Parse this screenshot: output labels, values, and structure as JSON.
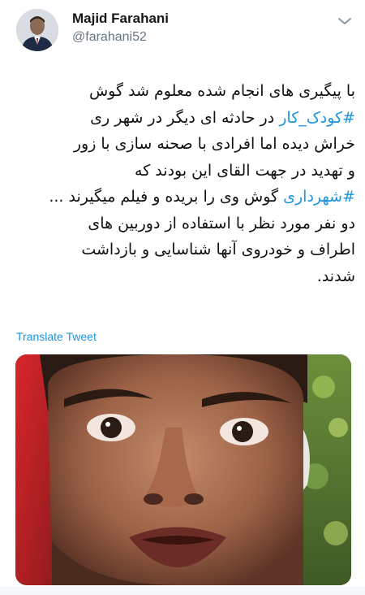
{
  "tweet": {
    "author": {
      "display_name": "Majid Farahani",
      "handle": "@farahani52",
      "avatar_icon": "user-avatar"
    },
    "menu_icon": "chevron-down-icon",
    "text_lines": [
      {
        "parts": [
          {
            "text": "با پیگیری های انجام شده معلوم شد گوش",
            "hashtag": false
          }
        ]
      },
      {
        "parts": [
          {
            "text": "#کودک_کار",
            "hashtag": true
          },
          {
            "text": " در حادثه ای دیگر در شهر ری",
            "hashtag": false
          }
        ]
      },
      {
        "parts": [
          {
            "text": "خراش دیده اما افرادی با صحنه سازی با زور",
            "hashtag": false
          }
        ]
      },
      {
        "parts": [
          {
            "text": "و تهدید در جهت القای این بودند که",
            "hashtag": false
          }
        ]
      },
      {
        "parts": [
          {
            "text": "#شهرداری",
            "hashtag": true
          },
          {
            "text": " گوش وی را بریده و فیلم میگیرند ...",
            "hashtag": false
          }
        ]
      },
      {
        "parts": [
          {
            "text": "دو نفر مورد نظر با استفاده از دوربین های",
            "hashtag": false
          }
        ]
      },
      {
        "parts": [
          {
            "text": "اطراف و خودروی آنها شناسایی و بازداشت",
            "hashtag": false
          }
        ]
      },
      {
        "parts": [
          {
            "text": "شدند.",
            "hashtag": false
          }
        ]
      }
    ],
    "translate_label": "Translate Tweet",
    "colors": {
      "link": "#1b95e0",
      "secondary_text": "#657786",
      "primary_text": "#14171a"
    }
  }
}
